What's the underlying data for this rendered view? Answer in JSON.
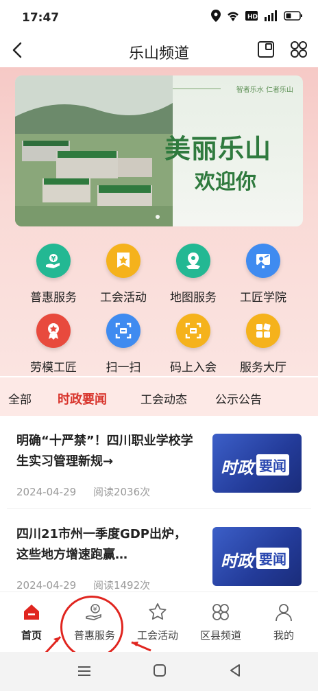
{
  "status_bar": {
    "time": "17:47"
  },
  "navbar": {
    "title": "乐山频道"
  },
  "banner": {
    "top_slogan": "智者乐水 仁者乐山",
    "slogan_line1": "美丽乐山",
    "slogan_line2": "欢迎你"
  },
  "services": [
    {
      "label": "普惠服务",
      "icon": "hand-coin-icon",
      "color": "#23b893"
    },
    {
      "label": "工会活动",
      "icon": "star-flag-icon",
      "color": "#f5b21c"
    },
    {
      "label": "地图服务",
      "icon": "map-pin-icon",
      "color": "#23b893"
    },
    {
      "label": "工匠学院",
      "icon": "presentation-icon",
      "color": "#3f8bf0"
    },
    {
      "label": "劳模工匠",
      "icon": "medal-icon",
      "color": "#e84a3d"
    },
    {
      "label": "扫一扫",
      "icon": "scan-icon",
      "color": "#3f8bf0"
    },
    {
      "label": "码上入会",
      "icon": "code-join-icon",
      "color": "#f5b21c"
    },
    {
      "label": "服务大厅",
      "icon": "grid-hall-icon",
      "color": "#f5b21c"
    }
  ],
  "tabs": [
    "全部",
    "时政要闻",
    "工会动态",
    "公示公告"
  ],
  "active_tab": "时政要闻",
  "news": [
    {
      "title": "明确“十严禁”！四川职业学校学生实习管理新规→",
      "date": "2024-04-29",
      "reads": "阅读2036次",
      "thumb_a": "时政",
      "thumb_b": "要闻"
    },
    {
      "title": "四川21市州一季度GDP出炉，这些地方增速跑赢…",
      "date": "2024-04-29",
      "reads": "阅读1492次",
      "thumb_a": "时政",
      "thumb_b": "要闻"
    }
  ],
  "tabbar": [
    {
      "label": "首页",
      "icon": "home-icon",
      "active": true
    },
    {
      "label": "普惠服务",
      "icon": "hand-coin-icon",
      "active": false
    },
    {
      "label": "工会活动",
      "icon": "star-icon",
      "active": false
    },
    {
      "label": "区县频道",
      "icon": "cloverleaf-icon",
      "active": false
    },
    {
      "label": "我的",
      "icon": "person-icon",
      "active": false
    }
  ],
  "colors": {
    "accent": "#d8342c",
    "hero_bg": "#f6c9c6",
    "thumb_blue": "#2a48b0"
  }
}
